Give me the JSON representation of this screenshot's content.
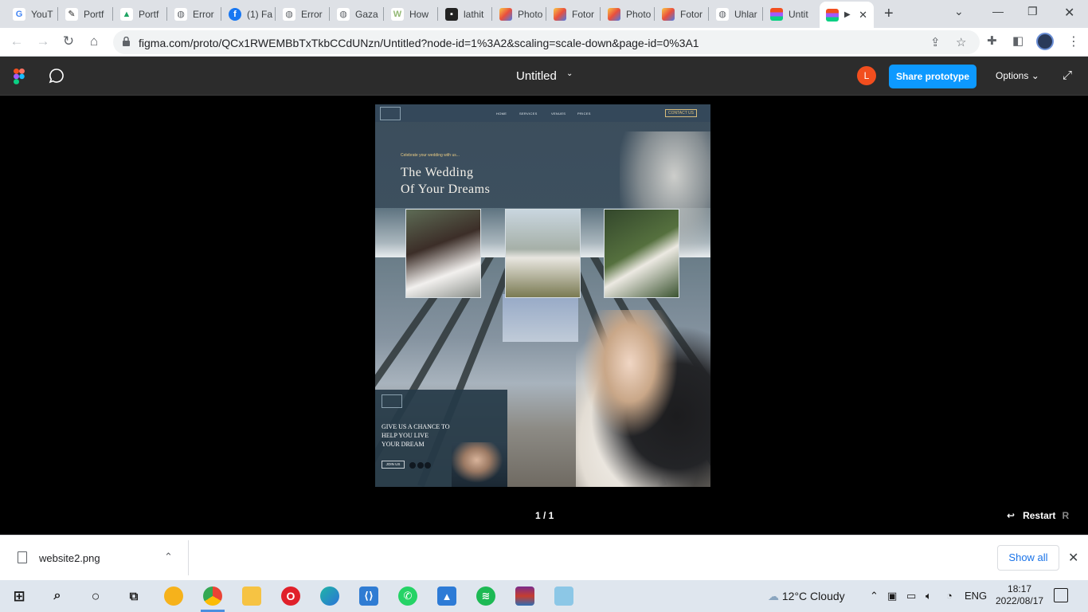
{
  "browser": {
    "tabs": [
      {
        "label": "YouT",
        "icon": "google-icon",
        "color": "#4285f4",
        "glyph": "G"
      },
      {
        "label": "Portf",
        "icon": "behance-like-icon",
        "color": "#222222",
        "glyph": "✎"
      },
      {
        "label": "Portf",
        "icon": "google-drive-icon",
        "color": "#1fa463",
        "glyph": "▲"
      },
      {
        "label": "Error",
        "icon": "globe-icon",
        "color": "#5f6368",
        "glyph": "◍"
      },
      {
        "label": "(1) Fa",
        "icon": "facebook-icon",
        "color": "#1877f2",
        "glyph": "f"
      },
      {
        "label": "Error",
        "icon": "globe-icon",
        "color": "#5f6368",
        "glyph": "◍"
      },
      {
        "label": "Gaza",
        "icon": "globe-icon",
        "color": "#5f6368",
        "glyph": "◍"
      },
      {
        "label": "How",
        "icon": "wikihow-icon",
        "color": "#93b874",
        "glyph": "W"
      },
      {
        "label": "lathit",
        "icon": "site-icon",
        "color": "#222222",
        "glyph": "▪"
      },
      {
        "label": "Photo",
        "icon": "photo-app-icon",
        "color": "#e94f3d",
        "glyph": "■"
      },
      {
        "label": "Fotor",
        "icon": "fotor-icon",
        "color": "#e94f3d",
        "glyph": "■"
      },
      {
        "label": "Photo",
        "icon": "photo-app-icon",
        "color": "#e94f3d",
        "glyph": "■"
      },
      {
        "label": "Fotor",
        "icon": "fotor-icon",
        "color": "#e94f3d",
        "glyph": "■"
      },
      {
        "label": "Uhlar",
        "icon": "globe-icon",
        "color": "#5f6368",
        "glyph": "◍"
      },
      {
        "label": "Untit",
        "icon": "figma-icon",
        "color": "#f24e1e",
        "glyph": "◆"
      }
    ],
    "active_tab_icon": "figma-icon",
    "url": "figma.com/proto/QCx1RWEMBbTxTkbCCdUNzn/Untitled?node-id=1%3A2&scaling=scale-down&page-id=0%3A1"
  },
  "figma": {
    "title": "Untitled",
    "avatar_initial": "L",
    "share_label": "Share prototype",
    "options_label": "Options",
    "pager": "1 / 1",
    "restart_label": "Restart",
    "restart_key": "R",
    "accent": "#0d99ff"
  },
  "site": {
    "nav": [
      "HOME",
      "SERVICES",
      "VENUES",
      "PRICES"
    ],
    "contact": "CONTACT US",
    "subtitle": "Celebrate your wedding with us...",
    "headline_1": "The Wedding",
    "headline_2": "Of Your Dreams",
    "card_line_1": "GIVE US A CHANCE TO",
    "card_line_2": "HELP YOU LIVE",
    "card_line_3": "YOUR DREAM",
    "join": "JOIN US"
  },
  "download": {
    "filename": "website2.png",
    "show_all": "Show all"
  },
  "taskbar": {
    "weather": "12°C  Cloudy",
    "lang": "ENG",
    "time": "18:17",
    "date": "2022/08/17"
  }
}
